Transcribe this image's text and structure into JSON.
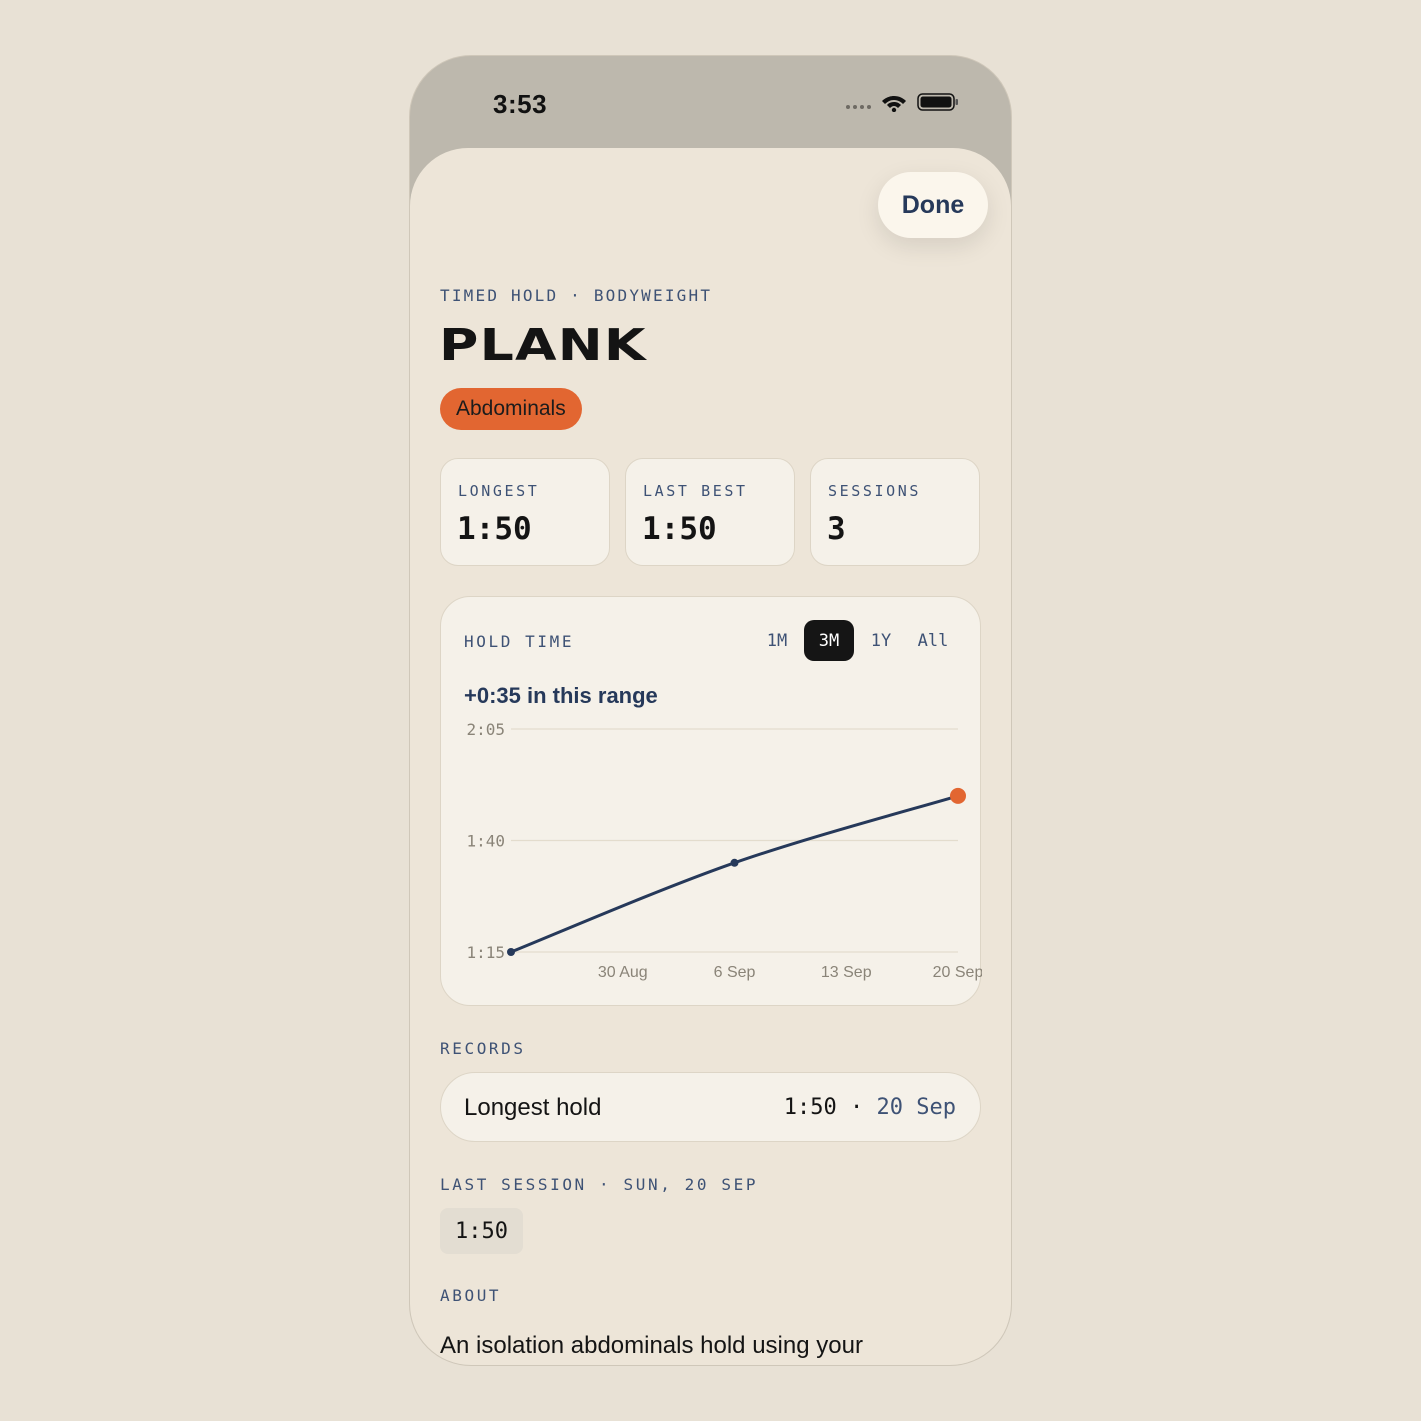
{
  "status_bar": {
    "time": "3:53",
    "icons": [
      "signal-dots-icon",
      "wifi-icon",
      "battery-icon"
    ]
  },
  "header": {
    "done_label": "Done"
  },
  "exercise": {
    "eyebrow": "TIMED HOLD · BODYWEIGHT",
    "title": "PLANK",
    "muscle": "Abdominals"
  },
  "stats": [
    {
      "label": "LONGEST",
      "value": "1:50"
    },
    {
      "label": "LAST BEST",
      "value": "1:50"
    },
    {
      "label": "SESSIONS",
      "value": "3"
    }
  ],
  "chart": {
    "title": "HOLD TIME",
    "ranges": [
      "1M",
      "3M",
      "1Y",
      "All"
    ],
    "selected_range": "3M",
    "delta": "+0:35 in this range"
  },
  "chart_data": {
    "type": "line",
    "title": "HOLD TIME",
    "xlabel": "",
    "ylabel": "",
    "x_ticks": [
      "30 Aug",
      "6 Sep",
      "13 Sep",
      "20 Sep"
    ],
    "y_ticks": [
      "1:15",
      "1:40",
      "2:05"
    ],
    "ylim_seconds": [
      75,
      125
    ],
    "series": [
      {
        "points": [
          {
            "date": "2026-08-23",
            "seconds": 75
          },
          {
            "date": "2026-09-06",
            "seconds": 95
          },
          {
            "date": "2026-09-20",
            "seconds": 110
          }
        ]
      }
    ],
    "grid": true,
    "colors": {
      "line": "#26395a",
      "last_point": "#e26631",
      "grid": "#e3dccd"
    }
  },
  "records": {
    "label": "RECORDS",
    "items": [
      {
        "name": "Longest hold",
        "value": "1:50",
        "date": "20 Sep"
      }
    ]
  },
  "last_session": {
    "label": "LAST SESSION · SUN, 20 SEP",
    "sets": [
      "1:50"
    ]
  },
  "about": {
    "label": "ABOUT",
    "text": "An isolation abdominals hold using your"
  },
  "colors": {
    "background": "#e8e1d5",
    "sheet": "#ede5d8",
    "accent": "#e26631",
    "navy": "#26395a"
  }
}
